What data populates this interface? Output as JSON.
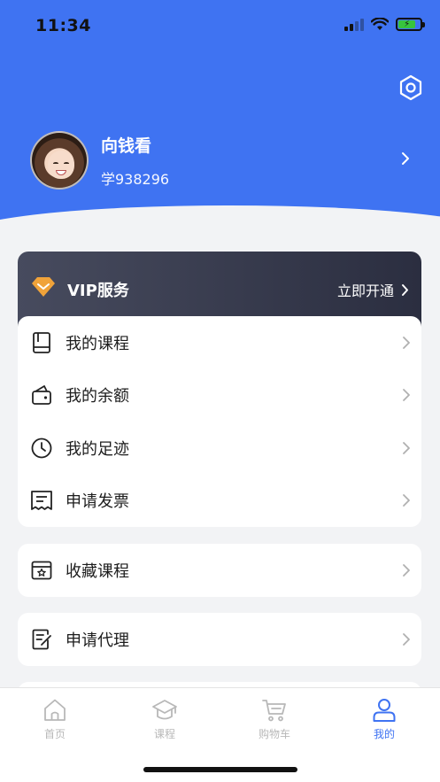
{
  "status_bar": {
    "time": "11:34"
  },
  "profile": {
    "name": "向钱看",
    "id": "学938296"
  },
  "vip": {
    "title": "VIP服务",
    "action": "立即开通"
  },
  "menu_group1": [
    {
      "label": "我的课程",
      "icon": "book-icon"
    },
    {
      "label": "我的余额",
      "icon": "wallet-icon"
    },
    {
      "label": "我的足迹",
      "icon": "clock-icon"
    },
    {
      "label": "申请发票",
      "icon": "receipt-icon"
    }
  ],
  "menu_group2": [
    {
      "label": "收藏课程",
      "icon": "favorite-course-icon"
    }
  ],
  "menu_group3": [
    {
      "label": "申请代理",
      "icon": "apply-agent-icon"
    }
  ],
  "tabbar": [
    {
      "label": "首页",
      "icon": "home-icon"
    },
    {
      "label": "课程",
      "icon": "graduation-cap-icon"
    },
    {
      "label": "购物车",
      "icon": "cart-icon"
    },
    {
      "label": "我的",
      "icon": "user-icon",
      "active": true
    }
  ],
  "colors": {
    "primary": "#3f73f2",
    "vip_gold": "#f0a33a",
    "vip_bg": "#2b2e40",
    "inactive": "#b8b8b8"
  }
}
